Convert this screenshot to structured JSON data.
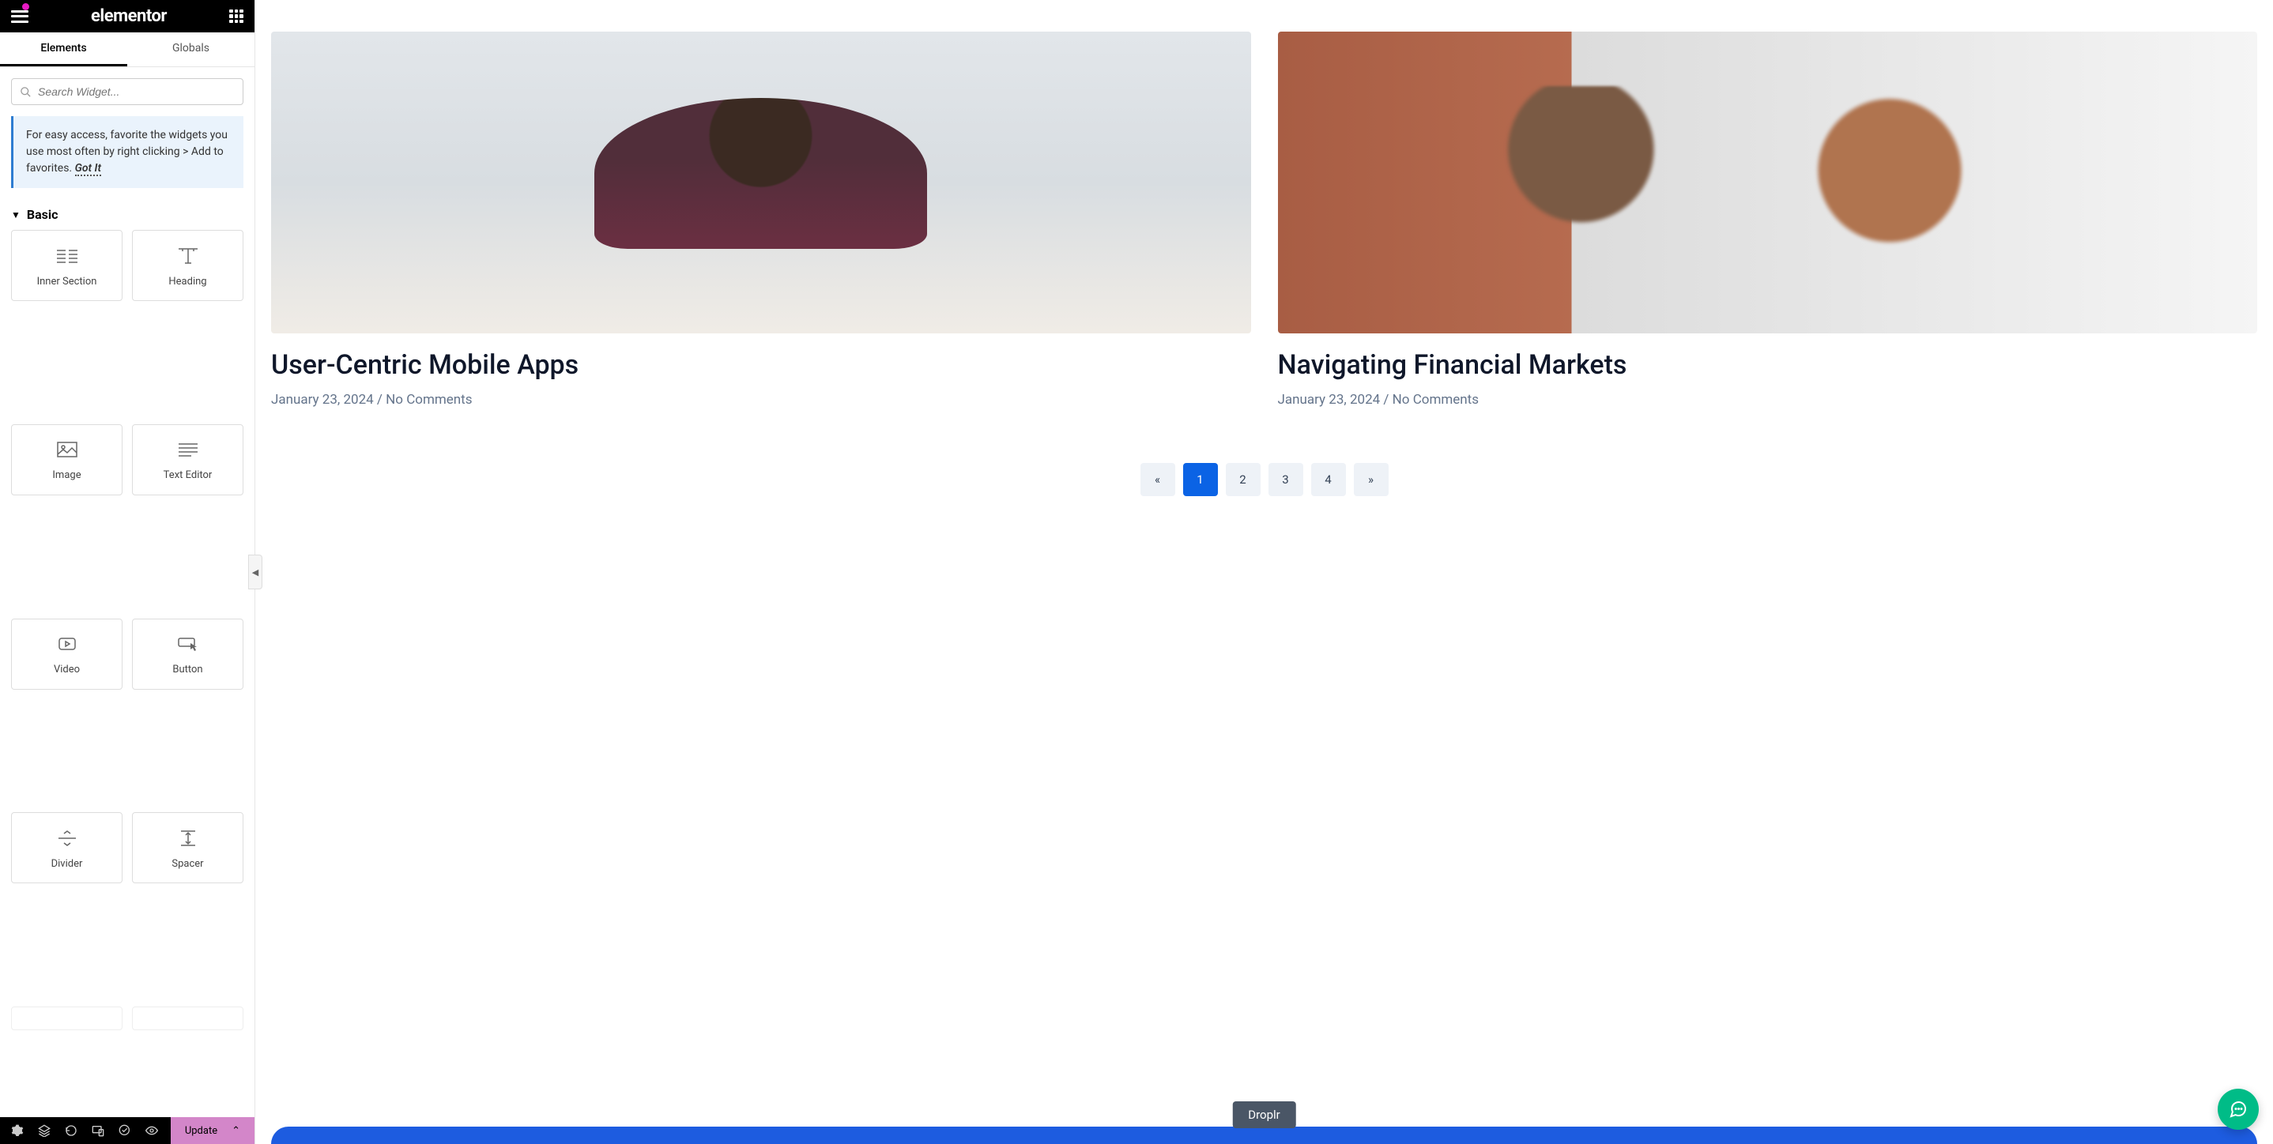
{
  "header": {
    "brand": "elementor"
  },
  "tabs": {
    "elements": "Elements",
    "globals": "Globals"
  },
  "search": {
    "placeholder": "Search Widget..."
  },
  "tip": {
    "text": "For easy access, favorite the widgets you use most often by right clicking > Add to favorites.",
    "gotit": "Got It"
  },
  "category": {
    "basic": "Basic"
  },
  "widgets": [
    {
      "label": "Inner Section"
    },
    {
      "label": "Heading"
    },
    {
      "label": "Image"
    },
    {
      "label": "Text Editor"
    },
    {
      "label": "Video"
    },
    {
      "label": "Button"
    },
    {
      "label": "Divider"
    },
    {
      "label": "Spacer"
    }
  ],
  "footer": {
    "update": "Update"
  },
  "posts": [
    {
      "title": "User-Centric Mobile Apps",
      "date": "January 23, 2024",
      "comments": "No Comments"
    },
    {
      "title": "Navigating Financial Markets",
      "date": "January 23, 2024",
      "comments": "No Comments"
    }
  ],
  "pagination": {
    "prev": "«",
    "pages": [
      "1",
      "2",
      "3",
      "4"
    ],
    "next": "»",
    "active": "1"
  },
  "tooltip": "Droplr"
}
